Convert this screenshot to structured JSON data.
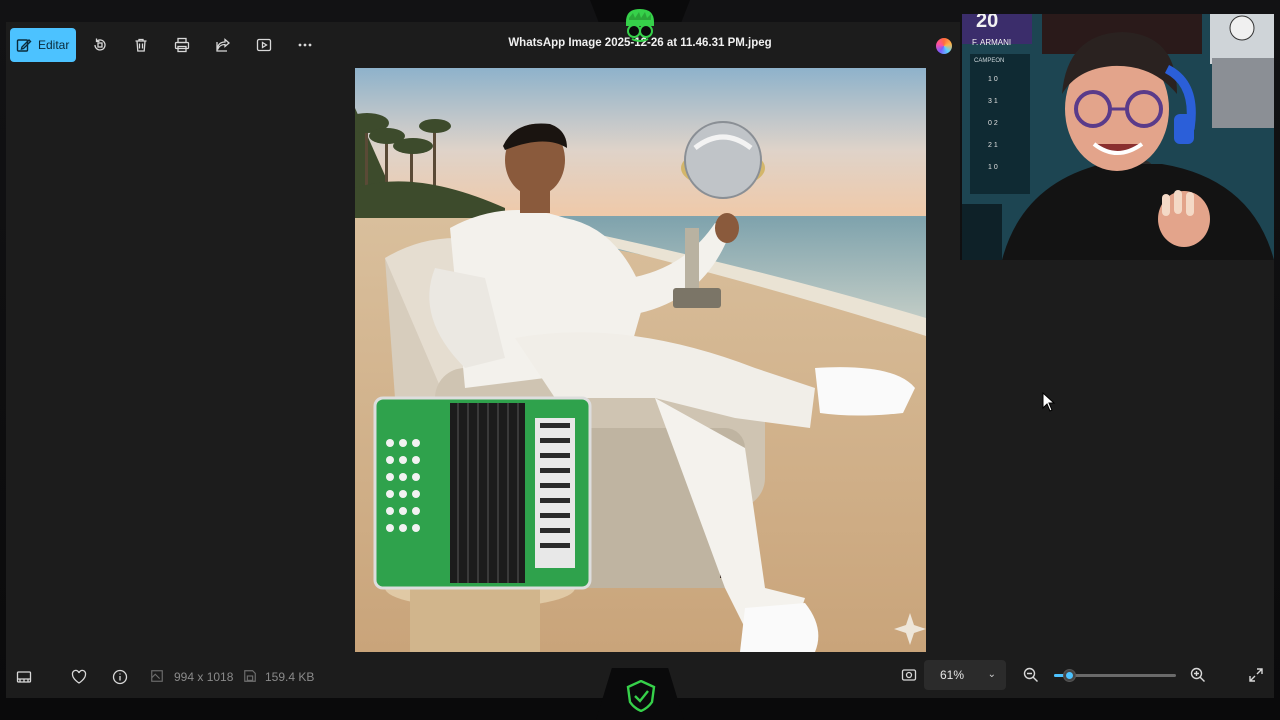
{
  "toolbar": {
    "edit_label": "Editar",
    "file_title": "WhatsApp Image 2025-12-26 at 11.46.31 PM.jpeg",
    "icons": [
      "edit-icon",
      "rotate-icon",
      "delete-icon",
      "print-icon",
      "share-icon",
      "slideshow-icon",
      "more-icon",
      "copilot-icon"
    ]
  },
  "photo": {
    "subject": "man in white outfit on beach armchair holding trophy with green accordion"
  },
  "statusbar": {
    "dimensions": "994 x 1018",
    "file_size": "159.4 KB",
    "zoom_value": "61%",
    "zoom_level_fraction": 0.12
  },
  "webcam": {
    "jersey_text": "F. ARMANI",
    "jersey_number": "20",
    "board_label": "CAMPEON",
    "scores": [
      "1 0",
      "3 1",
      "0 2",
      "2 1",
      "1 0"
    ]
  },
  "colors": {
    "accent": "#4cc2ff",
    "app_bg": "#1c1c1c",
    "logo_green": "#36d14a"
  }
}
